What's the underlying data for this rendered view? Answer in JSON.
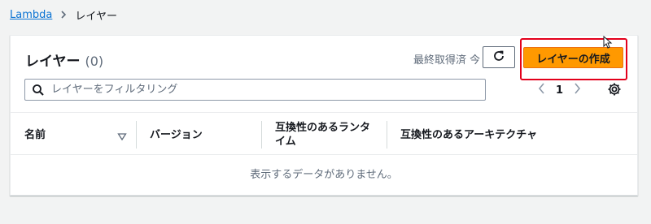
{
  "breadcrumb": {
    "parent": "Lambda",
    "current": "レイヤー"
  },
  "panel": {
    "title": "レイヤー",
    "count": "(0)",
    "last_fetched": "最終取得済 今",
    "create_label": "レイヤーの作成",
    "search_placeholder": "レイヤーをフィルタリング",
    "page_number": "1"
  },
  "table": {
    "headers": [
      "名前",
      "バージョン",
      "互換性のあるランタイム",
      "互換性のあるアーキテクチャ"
    ],
    "empty_text": "表示するデータがありません。"
  },
  "icons": [
    "chevron-right-icon",
    "refresh-icon",
    "search-icon",
    "chevron-left-icon",
    "chevron-right-icon",
    "gear-icon",
    "sort-down-icon",
    "mouse-cursor-icon"
  ],
  "colors": {
    "accent": "#ff9900",
    "link": "#0972d3",
    "highlight": "#e3001b"
  }
}
